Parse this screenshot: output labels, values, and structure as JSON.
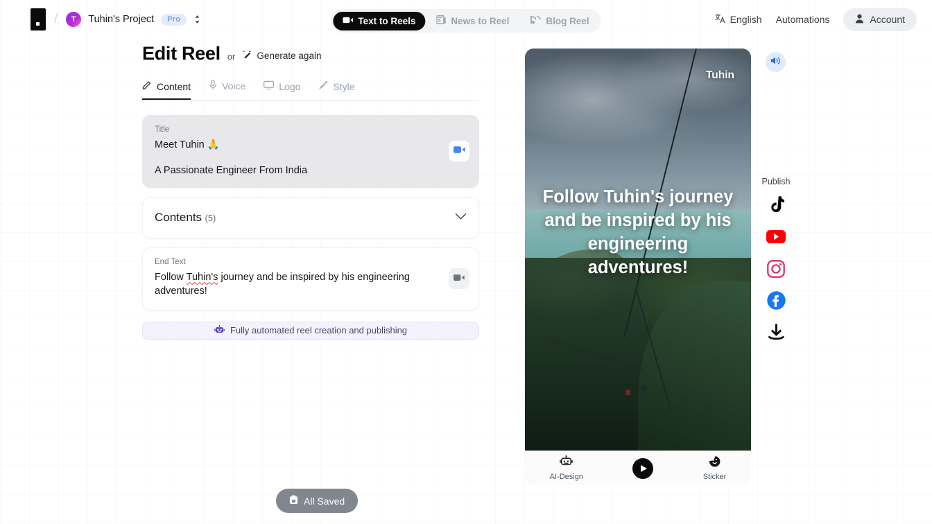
{
  "topbar": {
    "logo_icon": "app-logo-mark",
    "separator": "/",
    "project_initial": "T",
    "project_name": "Tuhin's Project",
    "plan_badge": "Pro",
    "switcher_icon": "chevron-up-down-icon",
    "segments": [
      {
        "label": "Text to Reels",
        "icon": "video-camera-icon",
        "active": true
      },
      {
        "label": "News to Reel",
        "icon": "newspaper-icon",
        "active": false
      },
      {
        "label": "Blog Reel",
        "icon": "blog-rss-icon",
        "active": false
      }
    ],
    "language": "English",
    "language_icon": "translate-icon",
    "automations": "Automations",
    "account": "Account",
    "account_icon": "person-icon"
  },
  "editor": {
    "page_title": "Edit Reel",
    "or_text": "or",
    "generate_again": "Generate again",
    "generate_again_icon": "magic-wand-icon",
    "tabs": [
      {
        "label": "Content",
        "icon": "pencil-edit-icon",
        "active": true
      },
      {
        "label": "Voice",
        "icon": "microphone-icon",
        "active": false
      },
      {
        "label": "Logo",
        "icon": "monitor-icon",
        "active": false
      },
      {
        "label": "Style",
        "icon": "paint-brush-icon",
        "active": false
      }
    ],
    "title_card": {
      "label": "Title",
      "value": "Meet Tuhin 🙏",
      "subtitle": "A Passionate Engineer From India",
      "action_icon": "video-camera-icon"
    },
    "contents_card": {
      "label": "Contents",
      "count": "(5)",
      "expand_icon": "chevron-down-icon"
    },
    "end_text_card": {
      "label": "End Text",
      "value_prefix": "Follow ",
      "value_misspelled": "Tuhin's",
      "value_rest": " journey and be inspired by his engineering adventures!",
      "action_icon": "video-camera-icon"
    },
    "automation_banner": {
      "icon": "robot-icon",
      "text": "Fully automated reel creation and publishing"
    },
    "saved_button": {
      "label": "All Saved",
      "icon": "save-icon"
    }
  },
  "preview": {
    "watermark": "Tuhin",
    "caption": "Follow Tuhin's journey and be inspired by his engineering adventures!",
    "sound_icon": "speaker-volume-icon",
    "toolbar": [
      {
        "label": "AI-Design",
        "icon": "robot-icon"
      },
      {
        "label": "",
        "icon": "play-icon"
      },
      {
        "label": "Sticker",
        "icon": "sticker-icon"
      }
    ]
  },
  "publish": {
    "label": "Publish",
    "targets": [
      {
        "name": "tiktok",
        "icon": "tiktok-icon",
        "color": "#000000"
      },
      {
        "name": "youtube",
        "icon": "youtube-icon",
        "color": "#FF0000"
      },
      {
        "name": "instagram",
        "icon": "instagram-icon",
        "color": "#E1306C"
      },
      {
        "name": "facebook",
        "icon": "facebook-icon",
        "color": "#1877F2"
      },
      {
        "name": "download",
        "icon": "download-icon",
        "color": "#111111"
      }
    ]
  },
  "colors": {
    "accent_blue": "#4285f4",
    "dark": "#0b0b0b",
    "banner_bg": "#f4f2fd",
    "pro_badge_bg": "#e3ecfd"
  }
}
